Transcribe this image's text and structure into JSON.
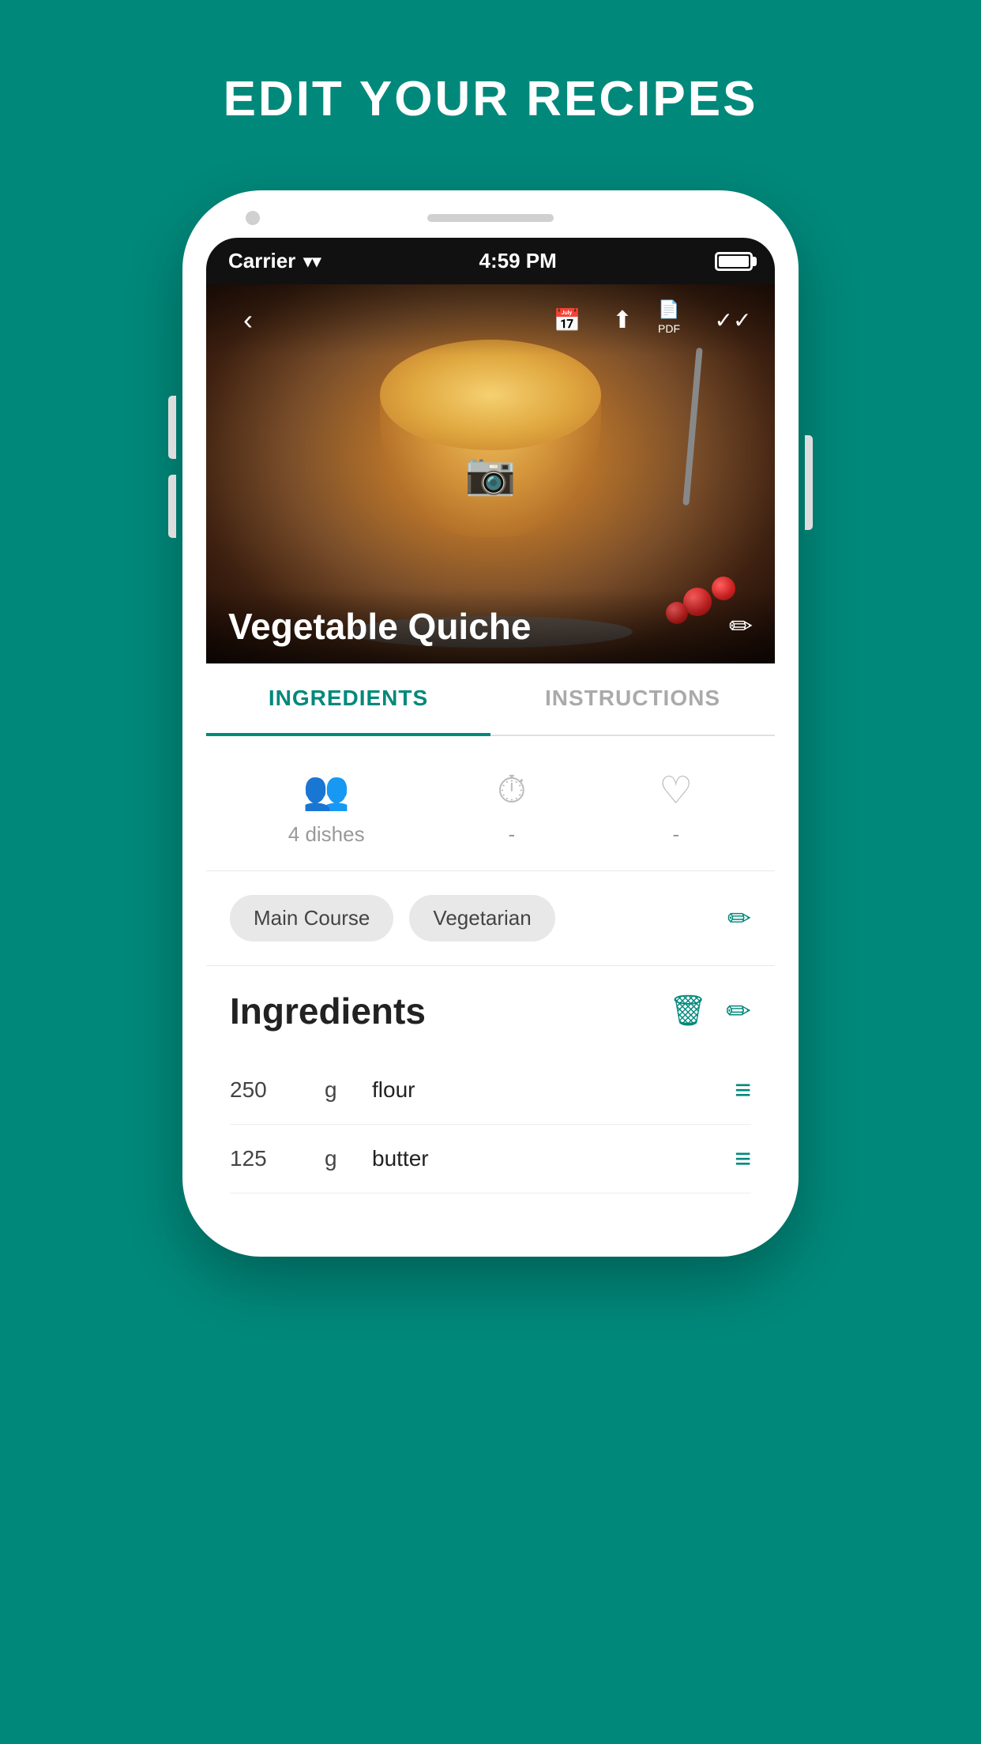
{
  "page": {
    "title": "EDIT YOUR RECIPES",
    "background_color": "#00897B"
  },
  "status_bar": {
    "carrier": "Carrier",
    "time": "4:59 PM"
  },
  "recipe": {
    "name": "Vegetable Quiche",
    "image_alt": "Vegetable Quiche photo"
  },
  "tabs": [
    {
      "label": "INGREDIENTS",
      "active": true
    },
    {
      "label": "INSTRUCTIONS",
      "active": false
    }
  ],
  "stats": [
    {
      "icon": "👥",
      "label": "4 dishes"
    },
    {
      "icon": "⏱",
      "label": "-"
    },
    {
      "icon": "♡",
      "label": "-"
    }
  ],
  "tags": [
    {
      "label": "Main Course"
    },
    {
      "label": "Vegetarian"
    }
  ],
  "ingredients_section": {
    "title": "Ingredients",
    "items": [
      {
        "amount": "250",
        "unit": "g",
        "name": "flour"
      },
      {
        "amount": "125",
        "unit": "g",
        "name": "butter"
      }
    ]
  },
  "icons": {
    "back": "‹",
    "calendar": "📅",
    "share": "↑",
    "pdf": "PDF",
    "check_all": "✓✓",
    "camera": "📷",
    "pencil": "✏",
    "pencil_small": "✏",
    "trash": "🗑",
    "drag": "≡",
    "tags_edit": "✏"
  }
}
